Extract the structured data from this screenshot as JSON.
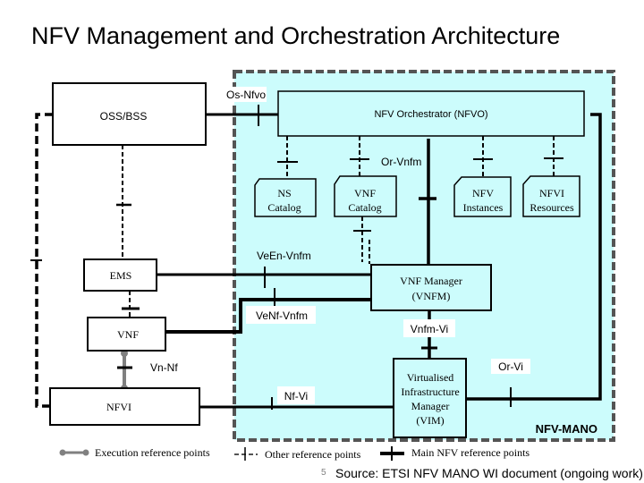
{
  "title": "NFV Management and Orchestration Architecture",
  "mano_label": "NFV-MANO",
  "colors": {
    "mano_fill": "#ccfcfc",
    "mano_border": "#545454",
    "line": "#000000",
    "execution_line": "#808080"
  },
  "nodes": {
    "oss_bss": "OSS/BSS",
    "nfvo": "NFV Orchestrator (NFVO)",
    "ns_catalog": [
      "NS",
      "Catalog"
    ],
    "vnf_catalog": [
      "VNF",
      "Catalog"
    ],
    "nfv_instances": [
      "NFV",
      "Instances"
    ],
    "nfvi_resources": [
      "NFVI",
      "Resources"
    ],
    "ems": "EMS",
    "vnfm": [
      "VNF Manager",
      "(VNFM)"
    ],
    "vnf": "VNF",
    "nfvi": "NFVI",
    "vim": [
      "Virtualised",
      "Infrastructure",
      "Manager",
      "(VIM)"
    ]
  },
  "reference_points": {
    "os_nfvo": "Os-Nfvo",
    "or_vnfm": "Or-Vnfm",
    "veen_vnfm": "VeEn-Vnfm",
    "venf_vnfm": "VeNf-Vnfm",
    "vnfm_vi": "Vnfm-Vi",
    "vn_nf": "Vn-Nf",
    "nf_vi": "Nf-Vi",
    "or_vi": "Or-Vi"
  },
  "legend": {
    "execution": "Execution reference points",
    "other": "Other reference points",
    "main": "Main NFV reference points"
  },
  "footer": {
    "page_number": "5",
    "source": "Source: ETSI NFV MANO WI document (ongoing work)"
  }
}
